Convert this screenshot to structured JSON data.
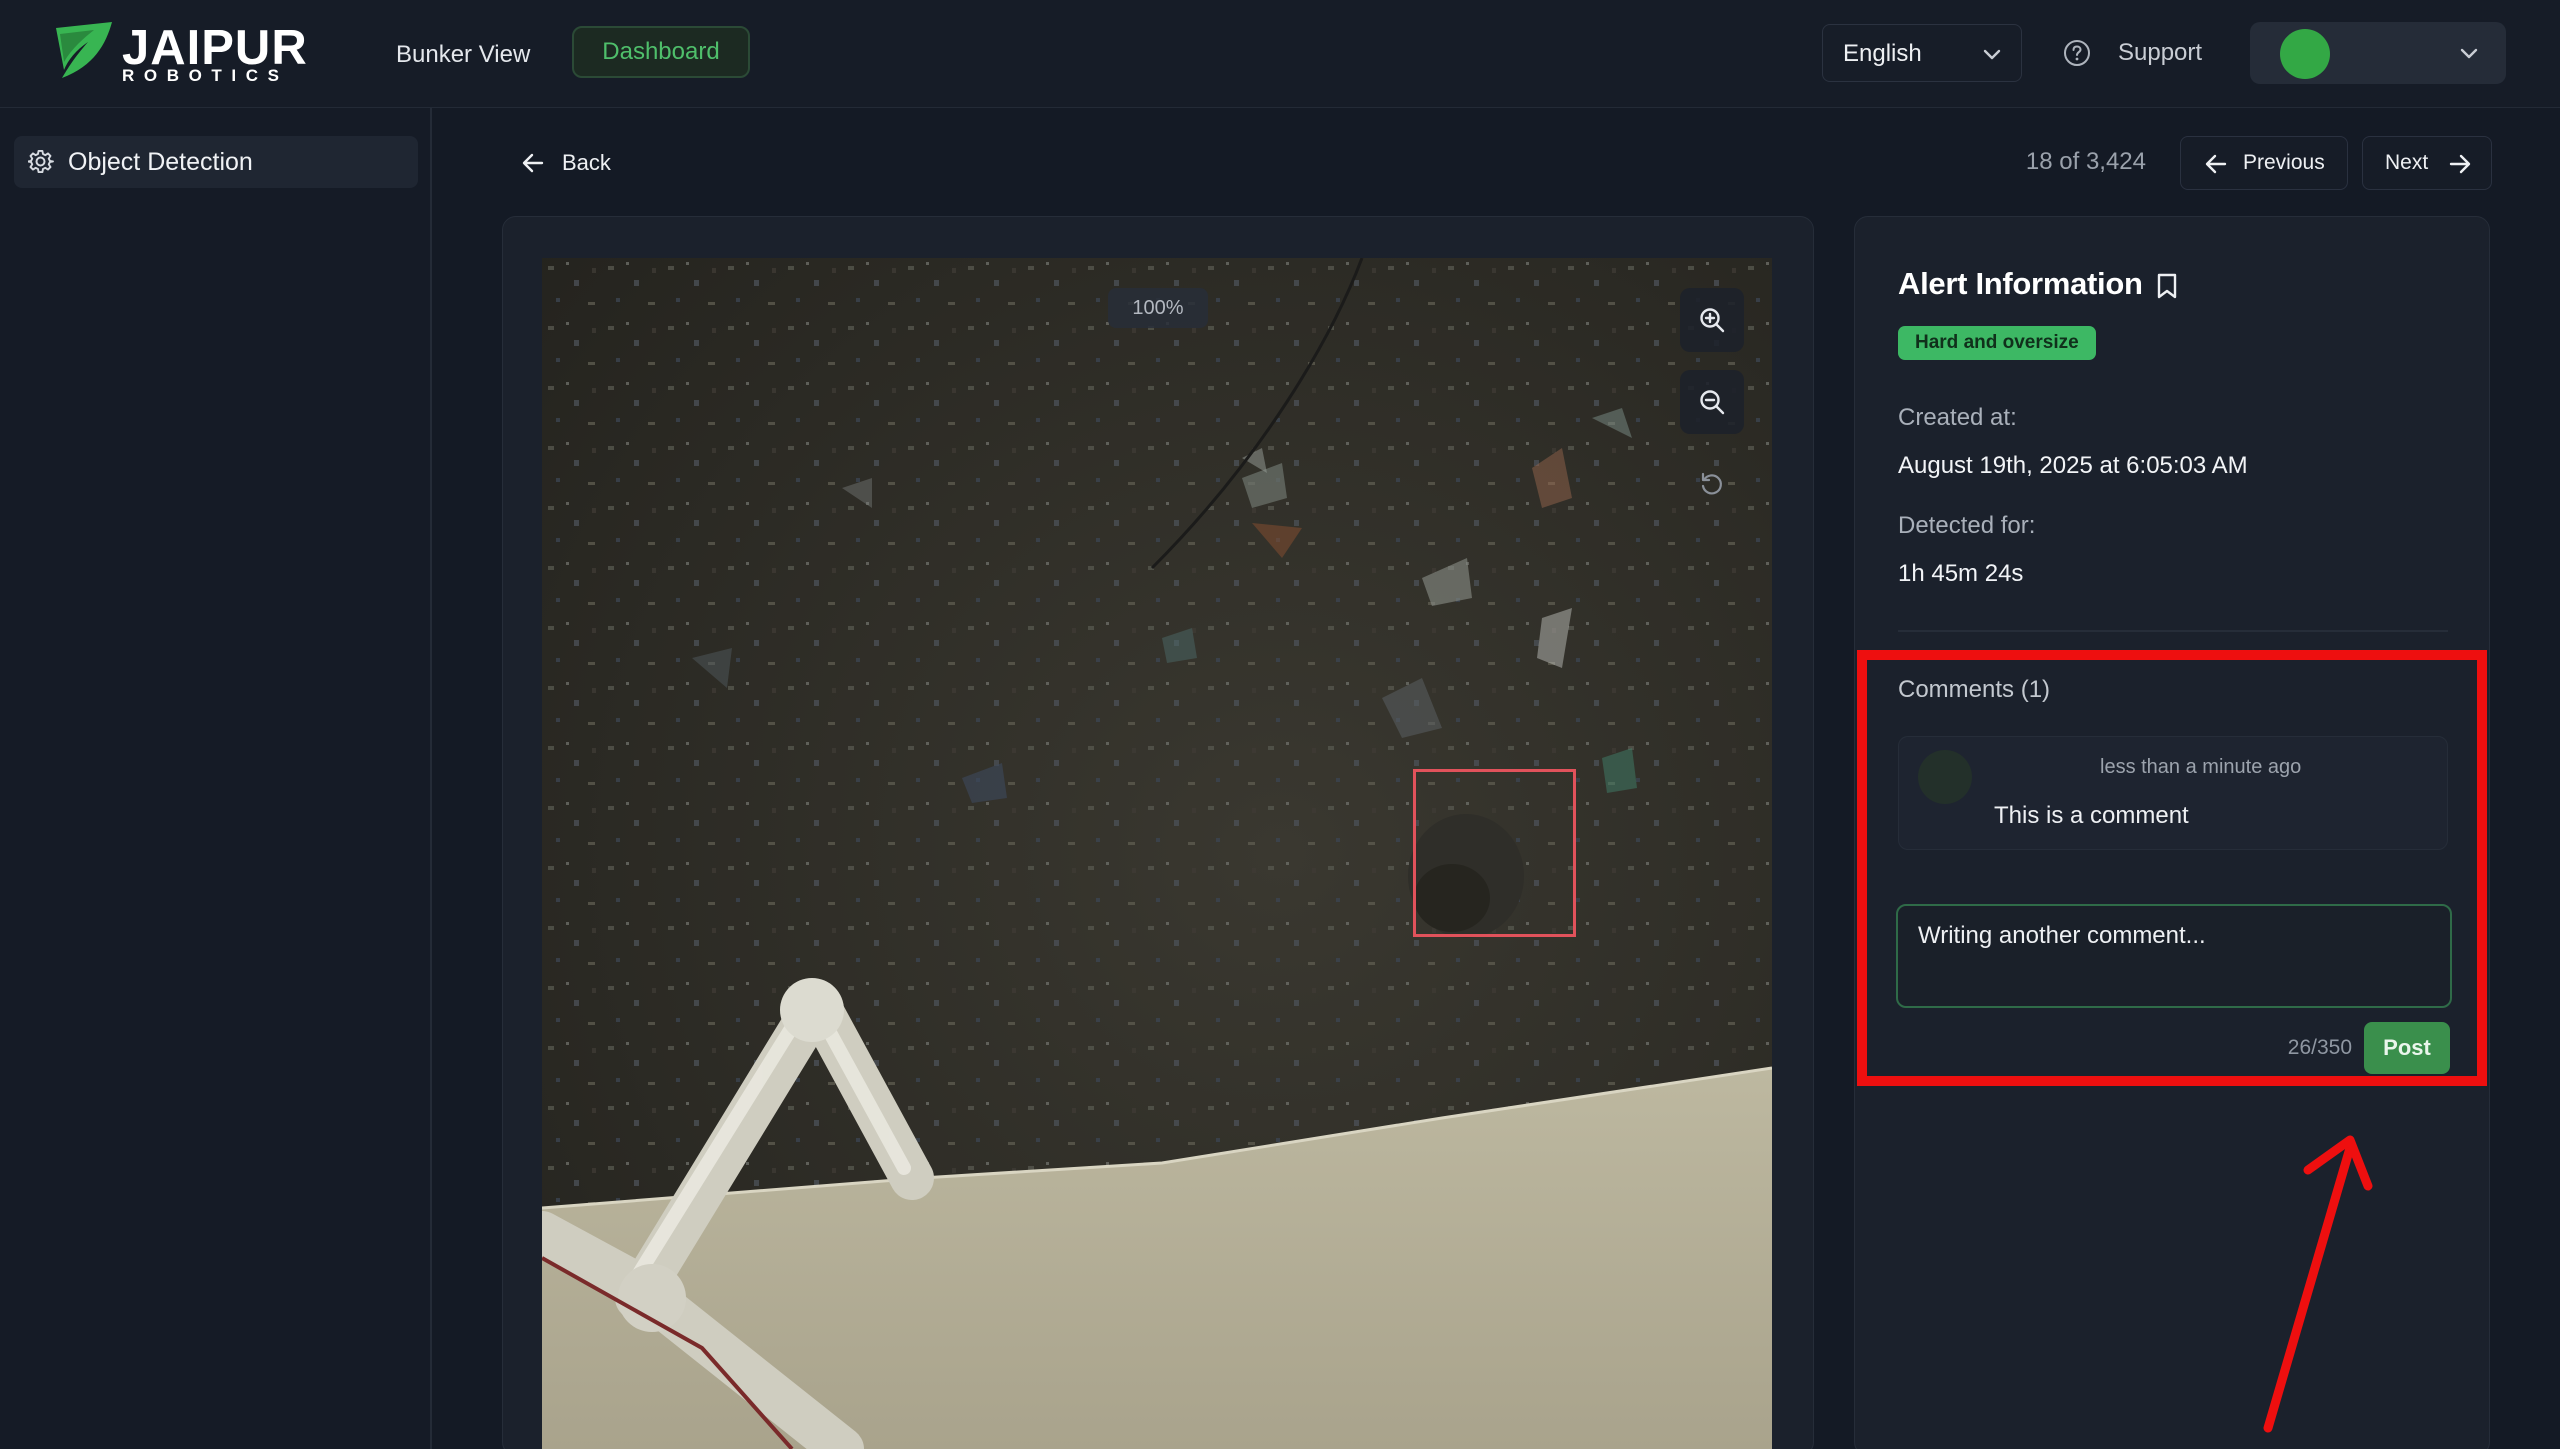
{
  "header": {
    "logo": {
      "word1": "JAIPUR",
      "word2": "ROBOTICS",
      "mark_color": "#38b552"
    },
    "nav": [
      {
        "label": "Bunker View",
        "active": false
      },
      {
        "label": "Dashboard",
        "active": true
      }
    ],
    "language": {
      "selected": "English"
    },
    "support_label": "Support",
    "user": {
      "avatar_color": "#33a845"
    }
  },
  "sidebar": {
    "items": [
      {
        "label": "Object Detection",
        "icon": "gear-icon",
        "active": true
      }
    ]
  },
  "toolbar": {
    "back_label": "Back",
    "counter": "18 of 3,424",
    "previous_label": "Previous",
    "next_label": "Next"
  },
  "viewer": {
    "zoom": "100%",
    "tools": [
      "zoom-in-icon",
      "zoom-out-icon",
      "reset-icon"
    ],
    "bbox_color": "#e1525b"
  },
  "alert": {
    "title": "Alert Information",
    "tag": "Hard and oversize",
    "tag_color": "#3db864",
    "created_label": "Created at:",
    "created_value": "August 19th, 2025 at 6:05:03 AM",
    "detected_label": "Detected for:",
    "detected_value": "1h 45m 24s"
  },
  "comments": {
    "title": "Comments (1)",
    "items": [
      {
        "time": "less than a minute ago",
        "text": "This is a comment"
      }
    ],
    "input_value": "Writing another comment...",
    "char_count": "26/350",
    "post_label": "Post"
  },
  "annotation": {
    "color": "#ee0f0f"
  }
}
